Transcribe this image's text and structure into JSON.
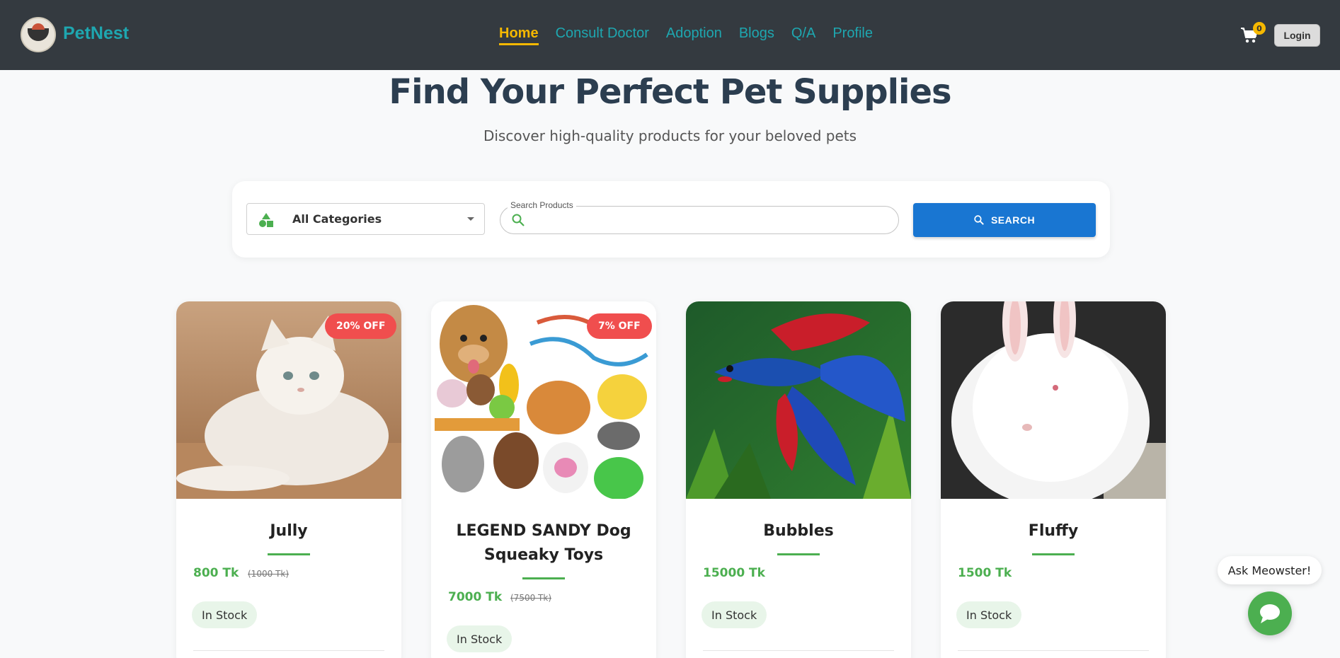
{
  "header": {
    "brand": "PetNest",
    "nav": [
      {
        "label": "Home",
        "active": true
      },
      {
        "label": "Consult Doctor"
      },
      {
        "label": "Adoption"
      },
      {
        "label": "Blogs"
      },
      {
        "label": "Q/A"
      },
      {
        "label": "Profile"
      }
    ],
    "cart_count": "0",
    "login_label": "Login",
    "accent": "#f5b800",
    "link_color": "#1ea7b0",
    "bg": "#343a40"
  },
  "hero": {
    "title": "Find Your Perfect Pet Supplies",
    "subtitle": "Discover high-quality products for your beloved pets"
  },
  "search": {
    "category_selected": "All Categories",
    "category_icon": "category-shapes-icon",
    "field_label": "Search Products",
    "value": "",
    "button_label": "SEARCH",
    "button_color": "#1976d2"
  },
  "products": [
    {
      "name": "Jully",
      "price": "800 Tk",
      "old_price": "(1000 Tk)",
      "discount": "20% OFF",
      "stock": "In Stock",
      "image": "white-persian-cat"
    },
    {
      "name": "LEGEND SANDY Dog Squeaky Toys",
      "price": "7000 Tk",
      "old_price": "(7500 Tk)",
      "discount": "7% OFF",
      "stock": "In Stock",
      "image": "dog-plush-toys"
    },
    {
      "name": "Bubbles",
      "price": "15000 Tk",
      "old_price": "",
      "discount": "",
      "stock": "In Stock",
      "image": "betta-fish"
    },
    {
      "name": "Fluffy",
      "price": "1500 Tk",
      "old_price": "",
      "discount": "",
      "stock": "In Stock",
      "image": "white-angora-rabbit"
    }
  ],
  "chat": {
    "prompt": "Ask Meowster!",
    "icon": "chat-bubble-icon",
    "color": "#4caf50"
  }
}
